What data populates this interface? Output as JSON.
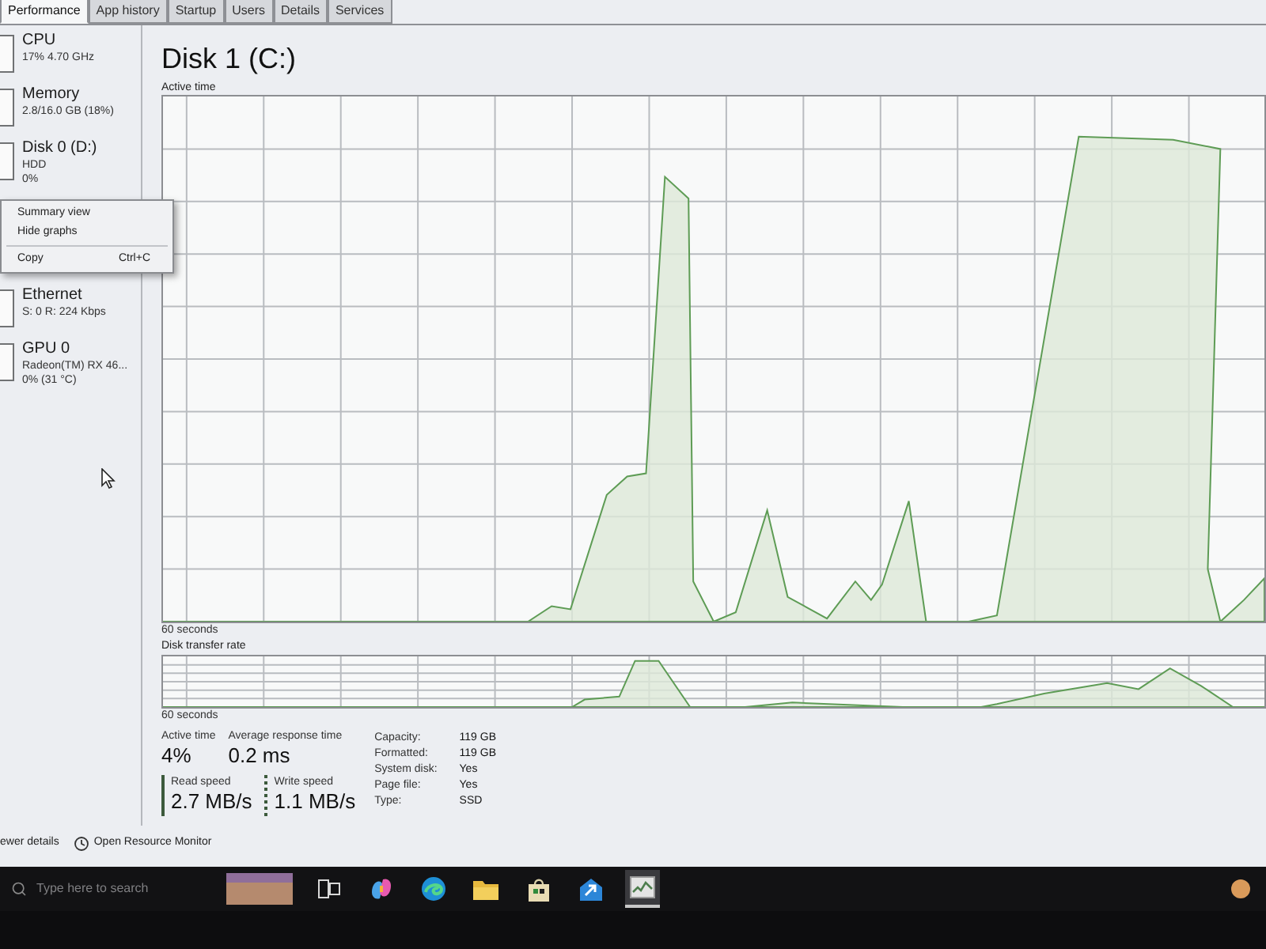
{
  "window": {
    "tabs": [
      {
        "label": "Performance",
        "selected": true
      },
      {
        "label": "App history",
        "selected": false
      },
      {
        "label": "Startup",
        "selected": false
      },
      {
        "label": "Users",
        "selected": false
      },
      {
        "label": "Details",
        "selected": false
      },
      {
        "label": "Services",
        "selected": false
      }
    ]
  },
  "sidebar": {
    "items": [
      {
        "kind": "device",
        "name": "CPU",
        "lines": [
          "17% 4.70 GHz"
        ]
      },
      {
        "kind": "device",
        "name": "Memory",
        "lines": [
          "2.8/16.0 GB (18%)"
        ]
      },
      {
        "kind": "device",
        "name": "Disk 0 (D:)",
        "lines": [
          "HDD",
          "0%"
        ]
      },
      {
        "kind": "context-menu",
        "items": [
          {
            "label": "Summary view",
            "separator_before": false
          },
          {
            "label": "Hide graphs",
            "separator_before": false
          },
          {
            "label": "Copy",
            "shortcut": "Ctrl+C",
            "separator_before": true
          }
        ]
      },
      {
        "kind": "device",
        "name": "Ethernet",
        "lines": [
          "S: 0 R: 224 Kbps"
        ]
      },
      {
        "kind": "device",
        "name": "GPU 0",
        "lines": [
          "Radeon(TM) RX 46...",
          "0% (31 °C)"
        ]
      }
    ]
  },
  "detail": {
    "title": "Disk 1 (C:)",
    "active_time_graph": {
      "label": "Active time",
      "time_span": "60 seconds"
    },
    "transfer_rate_graph": {
      "label": "Disk transfer rate",
      "time_span": "60 seconds"
    },
    "stats": [
      {
        "label": "Active time",
        "value": "4%"
      },
      {
        "label": "Average response time",
        "value": "0.2 ms"
      }
    ],
    "speeds": [
      {
        "kind": "read",
        "label": "Read speed",
        "value": "2.7 MB/s"
      },
      {
        "kind": "write",
        "label": "Write speed",
        "value": "1.1 MB/s"
      }
    ],
    "properties": [
      {
        "label": "Capacity:",
        "value": "119 GB"
      },
      {
        "label": "Formatted:",
        "value": "119 GB"
      },
      {
        "label": "System disk:",
        "value": "Yes"
      },
      {
        "label": "Page file:",
        "value": "Yes"
      },
      {
        "label": "Type:",
        "value": "SSD"
      }
    ]
  },
  "footer": {
    "fewer_details": "ewer details",
    "resource_monitor": "Open Resource Monitor"
  },
  "taskbar": {
    "search_placeholder": "Type here to search",
    "apps": [
      {
        "kind": "task-view",
        "active": false
      },
      {
        "kind": "ribbon",
        "active": false
      },
      {
        "kind": "browser",
        "active": false
      },
      {
        "kind": "folder",
        "active": false
      },
      {
        "kind": "bag",
        "active": false
      },
      {
        "kind": "arrow",
        "active": false
      },
      {
        "kind": "task-manager",
        "active": true
      }
    ]
  }
}
